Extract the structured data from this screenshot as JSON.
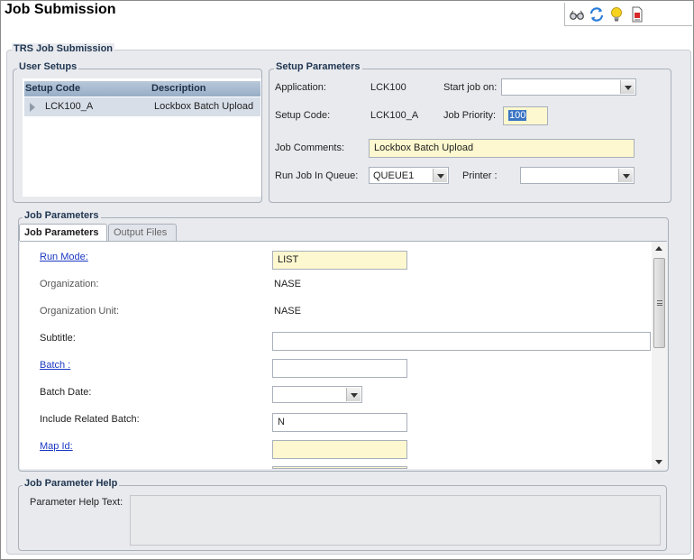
{
  "window": {
    "title": "Job Submission"
  },
  "toolbar": {
    "icons": [
      "glasses-icon",
      "refresh-icon",
      "lightbulb-icon",
      "report-icon"
    ]
  },
  "trs_group": {
    "label": "TRS Job Submission"
  },
  "user_setups": {
    "label": "User Setups",
    "columns": [
      "Setup Code",
      "Description"
    ],
    "rows": [
      {
        "setup_code": "LCK100_A",
        "description": "Lockbox Batch Upload"
      }
    ]
  },
  "setup_parameters": {
    "label": "Setup Parameters",
    "application_label": "Application:",
    "application_value": "LCK100",
    "start_job_label": "Start job on:",
    "start_job_value": "",
    "setup_code_label": "Setup Code:",
    "setup_code_value": "LCK100_A",
    "job_priority_label": "Job Priority:",
    "job_priority_value": "100",
    "job_comments_label": "Job Comments:",
    "job_comments_value": "Lockbox Batch Upload",
    "queue_label": "Run Job In Queue:",
    "queue_value": "QUEUE1",
    "printer_label": "Printer :",
    "printer_value": ""
  },
  "job_parameters": {
    "label": "Job Parameters",
    "tabs": [
      "Job Parameters",
      "Output Files"
    ],
    "run_mode_label": "Run Mode:",
    "run_mode_value": "LIST",
    "organization_label": "Organization:",
    "organization_value": "NASE",
    "org_unit_label": "Organization Unit:",
    "org_unit_value": "NASE",
    "subtitle_label": "Subtitle:",
    "subtitle_value": "",
    "batch_label": "Batch :",
    "batch_value": "",
    "batch_date_label": "Batch Date:",
    "batch_date_value": "",
    "include_related_label": "Include Related Batch:",
    "include_related_value": "N",
    "map_id_label": "Map Id:",
    "map_id_value": ""
  },
  "help": {
    "label": "Job Parameter Help",
    "text_label": "Parameter Help Text:",
    "text_value": ""
  }
}
